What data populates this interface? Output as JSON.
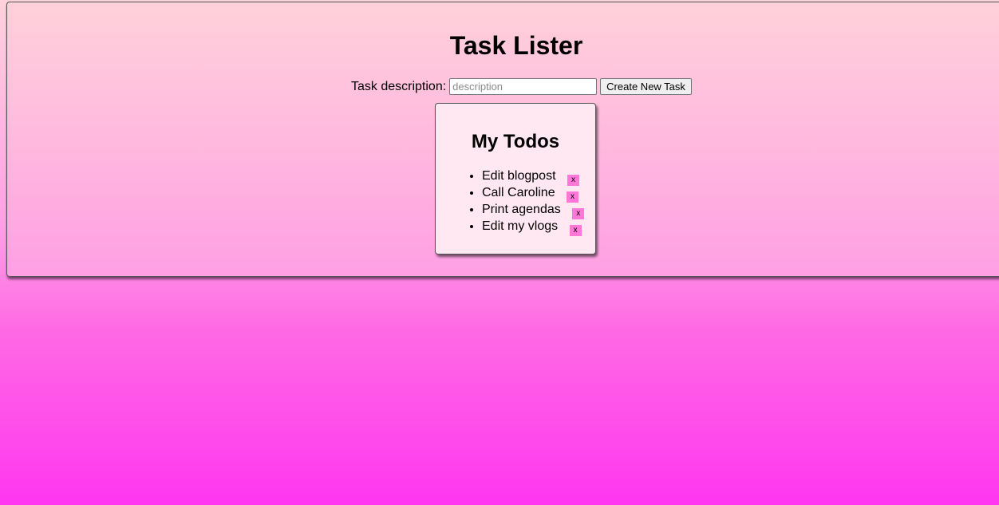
{
  "page": {
    "title": "Task Lister"
  },
  "form": {
    "label": "Task description:",
    "input_placeholder": "description",
    "input_value": "",
    "submit_label": "Create New Task"
  },
  "todos": {
    "title": "My Todos",
    "delete_label": "x",
    "items": [
      {
        "text": "Edit blogpost"
      },
      {
        "text": "Call Caroline"
      },
      {
        "text": "Print agendas"
      },
      {
        "text": "Edit my vlogs"
      }
    ]
  },
  "colors": {
    "delete_button": "#ff78d8",
    "card_background": "#ffe8f1"
  }
}
